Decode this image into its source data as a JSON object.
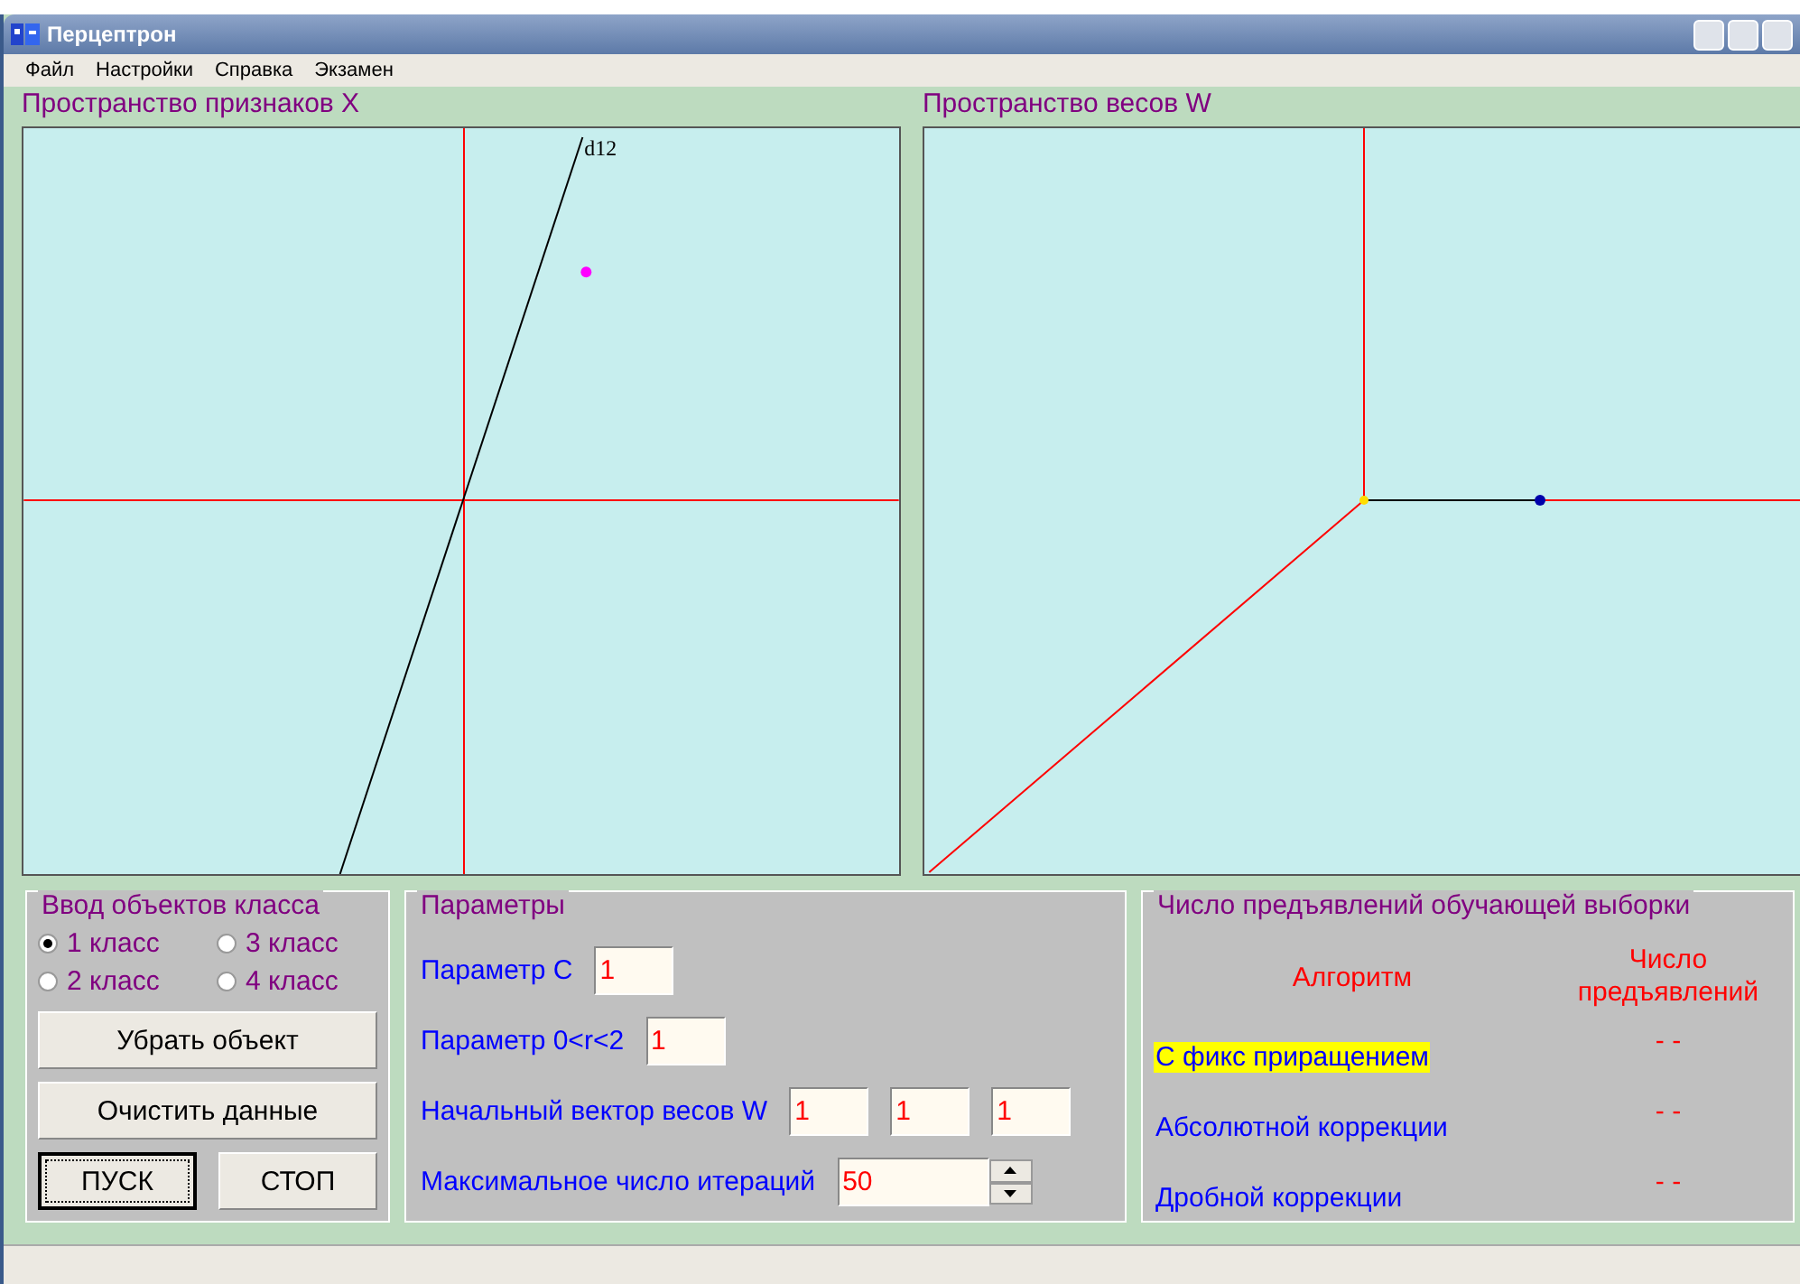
{
  "window": {
    "title": "Перцептрон"
  },
  "menu": [
    "Файл",
    "Настройки",
    "Справка",
    "Экзамен"
  ],
  "feature_space": {
    "title": "Пространство признаков X",
    "line_label": "d12"
  },
  "weight_space": {
    "title": "Пространство весов W"
  },
  "class_input": {
    "title": "Ввод объектов класса",
    "classes": [
      {
        "label": "1 класс",
        "selected": true
      },
      {
        "label": "3 класс",
        "selected": false
      },
      {
        "label": "2 класс",
        "selected": false
      },
      {
        "label": "4 класс",
        "selected": false
      }
    ],
    "buttons": [
      {
        "label": "Убрать объект",
        "kind": "wide"
      },
      {
        "label": "Очистить данные",
        "kind": "wide"
      },
      {
        "label": "ПУСК",
        "kind": "focused"
      },
      {
        "label": "СТОП",
        "kind": "half"
      }
    ]
  },
  "parameters": {
    "title": "Параметры",
    "rows": [
      {
        "label": "Параметр C",
        "kind": "text",
        "values": [
          "1"
        ]
      },
      {
        "label": "Параметр 0<r<2",
        "kind": "text",
        "values": [
          "1"
        ]
      },
      {
        "label": "Начальный вектор весов W",
        "kind": "text",
        "values": [
          "1",
          "1",
          "1"
        ]
      },
      {
        "label": "Максимальное число итераций",
        "kind": "spin",
        "values": [
          "50"
        ]
      }
    ]
  },
  "presentations": {
    "title": "Число предъявлений обучающей выборки",
    "col_algorithm": "Алгоритм",
    "col_count": "Число предъявлений",
    "rows": [
      {
        "algorithm": "С фикс приращением",
        "count": "- -",
        "selected": true
      },
      {
        "algorithm": "Абсолютной коррекции",
        "count": "- -",
        "selected": false
      },
      {
        "algorithm": "Дробной коррекции",
        "count": "- -",
        "selected": false
      }
    ]
  }
}
